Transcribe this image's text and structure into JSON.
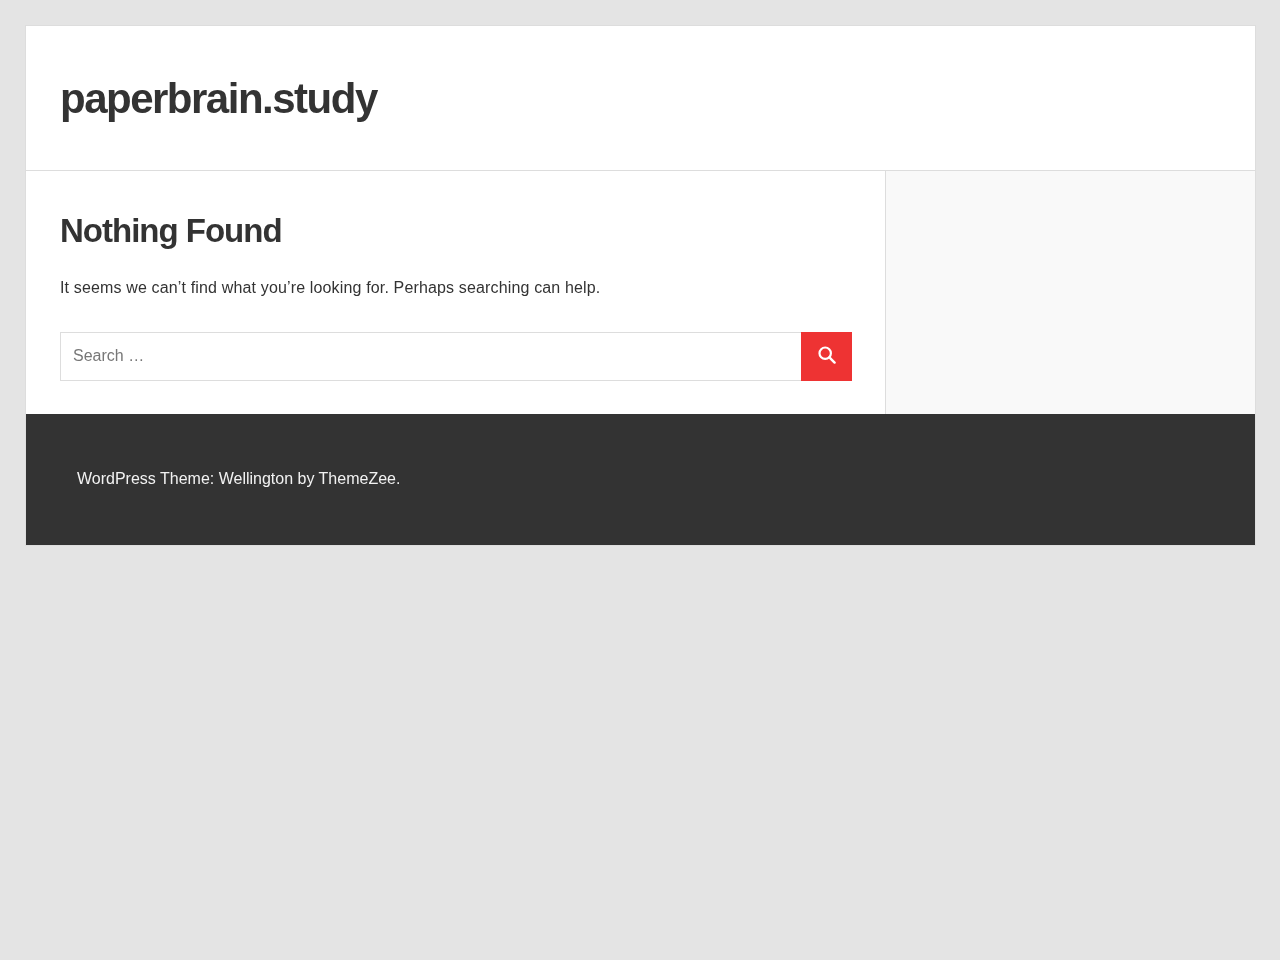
{
  "site": {
    "title": "paperbrain.study"
  },
  "content": {
    "heading": "Nothing Found",
    "message": "It seems we can’t find what you’re looking for. Perhaps searching can help.",
    "search": {
      "placeholder": "Search …"
    }
  },
  "footer": {
    "credit": "WordPress Theme: Wellington by ThemeZee."
  }
}
